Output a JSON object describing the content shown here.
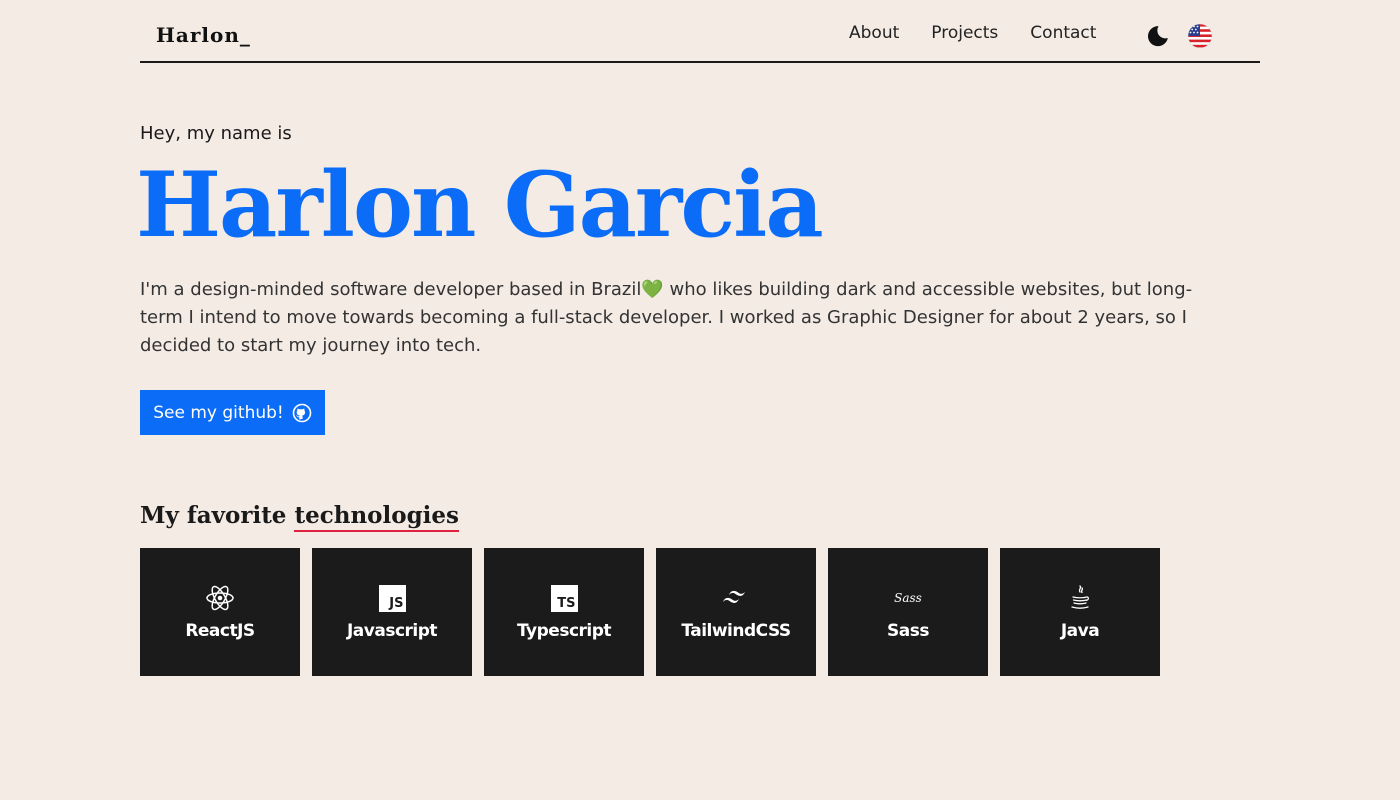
{
  "header": {
    "logo": "Harlon_",
    "nav": [
      {
        "label": "About"
      },
      {
        "label": "Projects"
      },
      {
        "label": "Contact"
      }
    ],
    "theme_icon": "moon-icon",
    "language_icon": "us-flag-icon"
  },
  "hero": {
    "greeting": "Hey, my name is",
    "name": "Harlon Garcia",
    "bio_part1": "I'm a design-minded software developer based in Brazil",
    "bio_heart": "💚",
    "bio_part2": " who likes building dark and accessible websites, but long-term I intend to move towards becoming a full-stack developer. I worked as Graphic Designer for about 2 years, so I decided to start my journey into tech.",
    "cta_label": "See my github!",
    "cta_icon": "github-icon"
  },
  "technologies": {
    "title_prefix": "My favorite",
    "title_highlight": "technologies",
    "items": [
      {
        "label": "ReactJS",
        "icon": "react-icon"
      },
      {
        "label": "Javascript",
        "icon": "javascript-icon",
        "icon_text": "JS"
      },
      {
        "label": "Typescript",
        "icon": "typescript-icon",
        "icon_text": "TS"
      },
      {
        "label": "TailwindCSS",
        "icon": "tailwind-icon"
      },
      {
        "label": "Sass",
        "icon": "sass-icon",
        "icon_text": "Sass"
      },
      {
        "label": "Java",
        "icon": "java-icon"
      }
    ]
  },
  "colors": {
    "background": "#f3ebe4",
    "accent": "#0b6cf7",
    "card": "#1b1b1b",
    "underline": "#e0223f"
  }
}
